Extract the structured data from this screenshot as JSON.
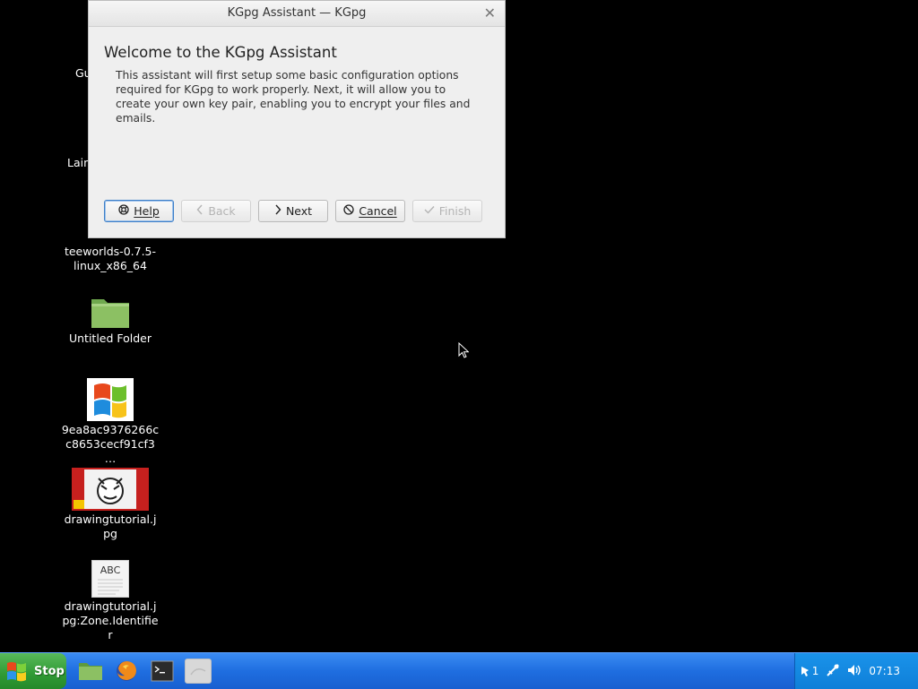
{
  "desktop": {
    "partial_labels": [
      "Gu",
      "Lain"
    ],
    "icons": [
      {
        "label": "teeworlds-0.7.5-linux_x86_64",
        "icon": "file-icon"
      },
      {
        "label": "Untitled Folder",
        "icon": "folder-icon"
      },
      {
        "label": "9ea8ac9376266cc8653cecf91cf3…",
        "icon": "windows-logo-image-icon"
      },
      {
        "label": "drawingtutorial.jpg",
        "icon": "image-thumbnail-icon"
      },
      {
        "label": "drawingtutorial.jpg:Zone.Identifier",
        "icon": "text-document-icon",
        "thumb_text": "ABC"
      }
    ]
  },
  "dialog": {
    "title": "KGpg Assistant — KGpg",
    "heading": "Welcome to the KGpg Assistant",
    "description": "This assistant will first setup some basic configuration options required for KGpg to work properly. Next, it will allow you to create your own key pair, enabling you to encrypt your files and emails.",
    "buttons": {
      "help": "Help",
      "back": "Back",
      "next": "Next",
      "cancel": "Cancel",
      "finish": "Finish"
    }
  },
  "taskbar": {
    "start_label": "Stop",
    "launchers": [
      "file-manager-icon",
      "firefox-icon",
      "terminal-icon",
      "blank-window-icon"
    ],
    "tray": {
      "notification_count": "1",
      "clock": "07:13"
    }
  }
}
